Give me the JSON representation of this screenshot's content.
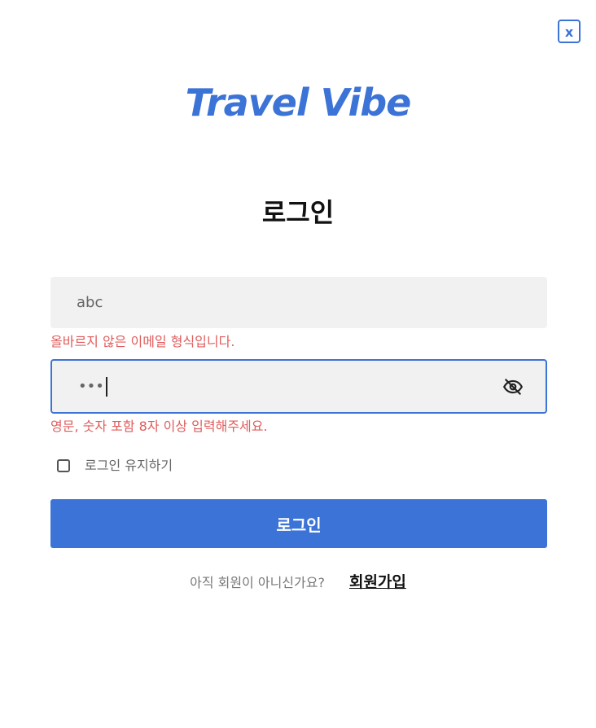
{
  "header": {
    "close_label": "x",
    "logo_text": "Travel Vibe"
  },
  "login": {
    "title": "로그인",
    "email_value": "abc",
    "email_error": "올바르지 않은 이메일 형식입니다.",
    "password_masked": "•••",
    "password_icon": "eye-off-icon",
    "password_error": "영문, 숫자 포함 8자 이상 입력해주세요.",
    "remember_label": "로그인 유지하기",
    "submit_label": "로그인",
    "signup_prompt": "아직 회원이 아니신가요?",
    "signup_link": "회원가입"
  },
  "colors": {
    "accent": "#3c73d6",
    "error": "#e05c5c",
    "field_bg": "#f1f1f1"
  }
}
